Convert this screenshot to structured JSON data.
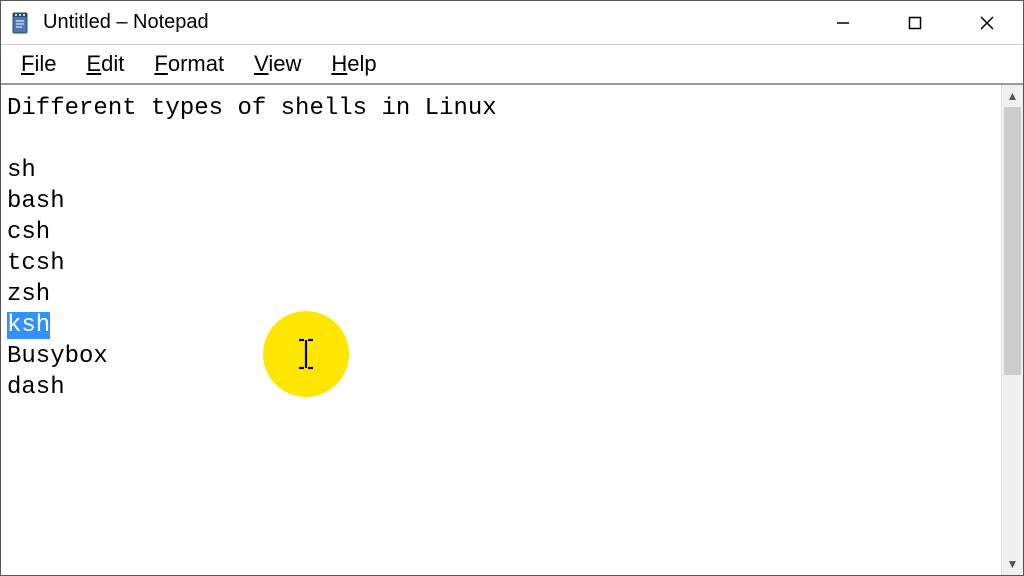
{
  "titlebar": {
    "title": "Untitled – Notepad"
  },
  "menu": {
    "file": "File",
    "edit": "Edit",
    "format": "Format",
    "view": "View",
    "help": "Help"
  },
  "editor": {
    "lines": [
      "Different types of shells in Linux",
      "",
      "sh",
      "bash",
      "csh",
      "tcsh",
      "zsh",
      "ksh",
      "Busybox",
      "dash"
    ],
    "selected_line_index": 7
  }
}
